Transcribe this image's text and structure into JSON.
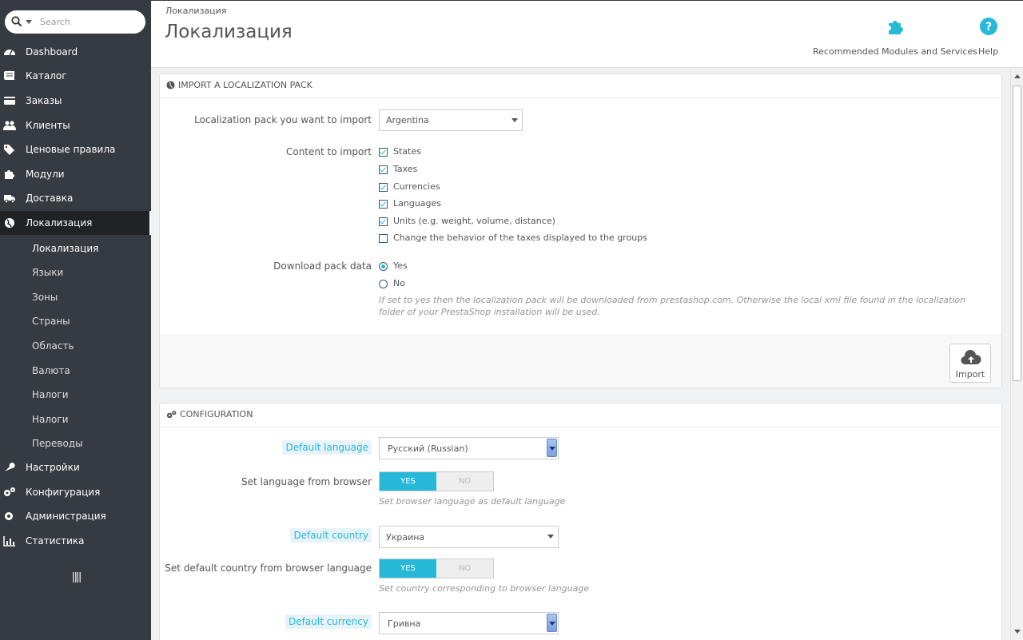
{
  "search": {
    "placeholder": "Search"
  },
  "sidebar": {
    "items": [
      {
        "label": "Dashboard",
        "icon": "dashboard-icon"
      },
      {
        "label": "Каталог",
        "icon": "book-icon"
      },
      {
        "label": "Заказы",
        "icon": "credit-card-icon"
      },
      {
        "label": "Клиенты",
        "icon": "users-icon"
      },
      {
        "label": "Ценовые правила",
        "icon": "tags-icon"
      },
      {
        "label": "Модули",
        "icon": "puzzle-icon"
      },
      {
        "label": "Доставка",
        "icon": "truck-icon"
      },
      {
        "label": "Локализация",
        "icon": "globe-icon"
      },
      {
        "label": "Настройки",
        "icon": "wrench-icon"
      },
      {
        "label": "Конфигурация",
        "icon": "cogs-icon"
      },
      {
        "label": "Администрация",
        "icon": "cog-icon"
      },
      {
        "label": "Статистика",
        "icon": "bar-chart-icon"
      }
    ],
    "submenu": [
      "Локализация",
      "Языки",
      "Зоны",
      "Страны",
      "Область",
      "Валюта",
      "Налоги",
      "Налоги",
      "Переводы"
    ]
  },
  "header": {
    "breadcrumb": "Локализация",
    "title": "Локализация",
    "modules_label": "Recommended Modules and Services",
    "help_label": "Help"
  },
  "import_panel": {
    "heading": "IMPORT A LOCALIZATION PACK",
    "pack_label": "Localization pack you want to import",
    "pack_value": "Argentina",
    "content_label": "Content to import",
    "content_options": [
      {
        "label": "States",
        "checked": true
      },
      {
        "label": "Taxes",
        "checked": true
      },
      {
        "label": "Currencies",
        "checked": true
      },
      {
        "label": "Languages",
        "checked": true
      },
      {
        "label": "Units (e.g. weight, volume, distance)",
        "checked": true
      },
      {
        "label": "Change the behavior of the taxes displayed to the groups",
        "checked": false
      }
    ],
    "download_label": "Download pack data",
    "download_yes": "Yes",
    "download_no": "No",
    "download_hint": "If set to yes then the localization pack will be downloaded from prestashop.com. Otherwise the local xml file found in the localization folder of your PrestaShop installation will be used.",
    "import_button": "Import"
  },
  "config_panel": {
    "heading": "CONFIGURATION",
    "default_language_label": "Default language",
    "default_language_value": "Русский (Russian)",
    "lang_browser_label": "Set language from browser",
    "lang_browser_hint": "Set browser language as default language",
    "default_country_label": "Default country",
    "default_country_value": "Украина",
    "country_browser_label": "Set default country from browser language",
    "country_browser_hint": "Set country corresponding to browser language",
    "default_currency_label": "Default currency",
    "default_currency_value": "Гривна",
    "switch_yes": "YES",
    "switch_no": "NO"
  },
  "colors": {
    "sidebar_bg": "#363a41",
    "accent": "#25b9d7",
    "active_bg": "#202226"
  }
}
